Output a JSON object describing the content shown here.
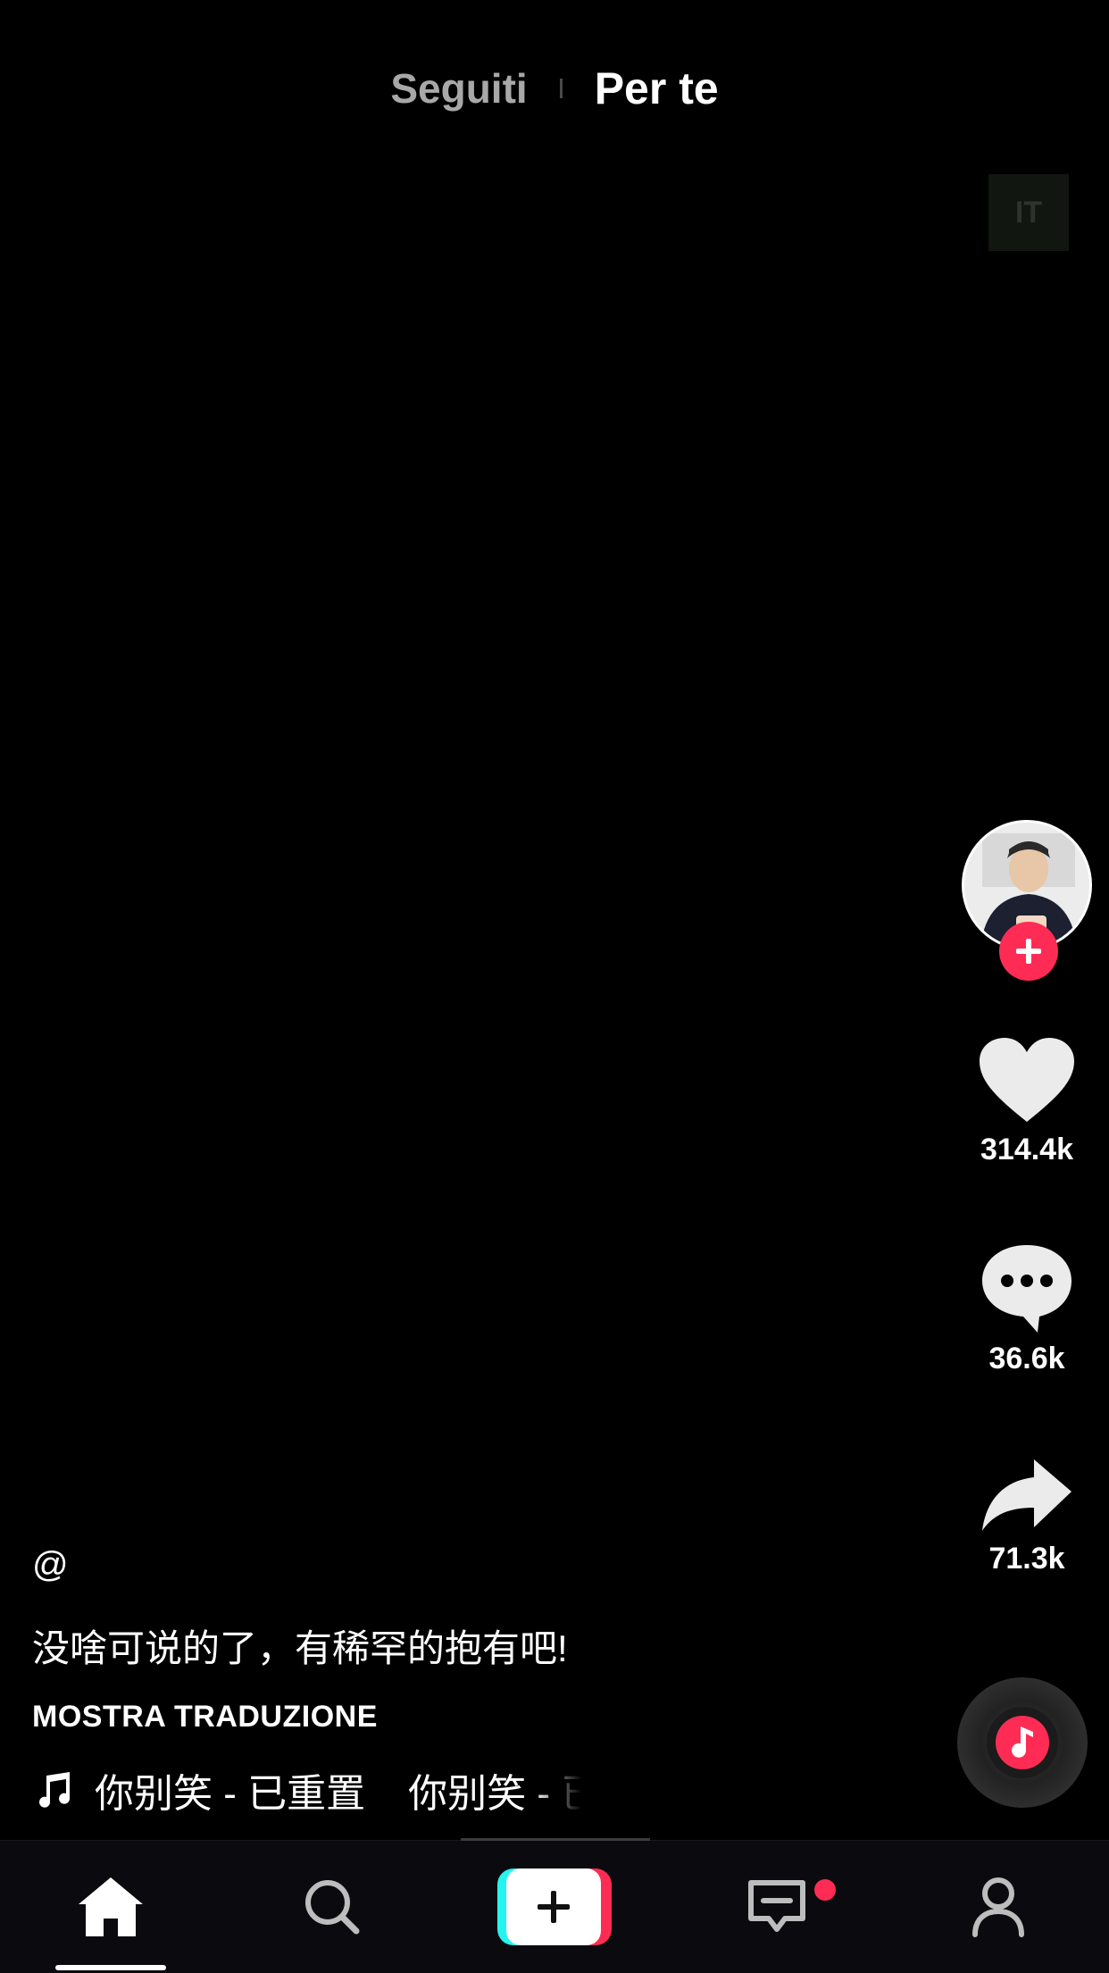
{
  "top_tabs": {
    "following": "Seguiti",
    "for_you": "Per te"
  },
  "language_badge": "IT",
  "actions": {
    "likes": "314.4k",
    "comments": "36.6k",
    "shares": "71.3k"
  },
  "post": {
    "username": "@",
    "caption": "没啥可说的了，有稀罕的抱有吧!",
    "translate_label": "MOSTRA TRADUZIONE",
    "music_items": [
      "你别笑 - 已重置",
      "你别笑 - 已重置"
    ]
  },
  "bottom_nav": {
    "items": [
      "home-icon",
      "search-icon",
      "create-icon",
      "inbox-icon",
      "profile-icon"
    ],
    "inbox_has_notification": true
  },
  "colors": {
    "accent_red": "#fe2c55",
    "accent_cyan": "#25f4ee",
    "background": "#000000"
  }
}
